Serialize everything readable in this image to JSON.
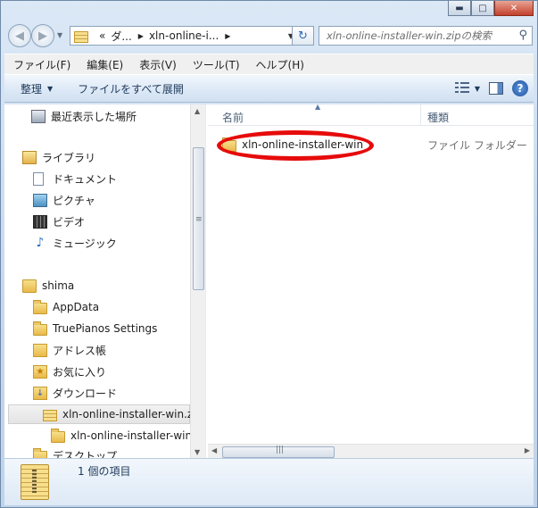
{
  "address": {
    "crumbs": [
      "«",
      "ダ...",
      "xln-online-i..."
    ],
    "search_placeholder": "xln-online-installer-win.zipの検索"
  },
  "menu": [
    "ファイル(F)",
    "編集(E)",
    "表示(V)",
    "ツール(T)",
    "ヘルプ(H)"
  ],
  "toolbar": {
    "organize_label": "整理",
    "extract_label": "ファイルをすべて展開"
  },
  "nav": {
    "recent": "最近表示した場所",
    "library": "ライブラリ",
    "documents": "ドキュメント",
    "pictures": "ピクチャ",
    "videos": "ビデオ",
    "music": "ミュージック",
    "user": "shima",
    "appdata": "AppData",
    "truepianos": "TruePianos Settings",
    "addressbook": "アドレス帳",
    "favorites": "お気に入り",
    "downloads": "ダウンロード",
    "zip": "xln-online-installer-win.zi",
    "zip_sub": "xln-online-installer-win",
    "desktop": "デスクトップ"
  },
  "columns": {
    "name": "名前",
    "type": "種類"
  },
  "files": [
    {
      "name": "xln-online-installer-win",
      "type": "ファイル フォルダー"
    }
  ],
  "status": {
    "count": "1 個の項目"
  },
  "colors": {
    "highlight": "#e60b0b",
    "selection": "#e4e4e4"
  }
}
